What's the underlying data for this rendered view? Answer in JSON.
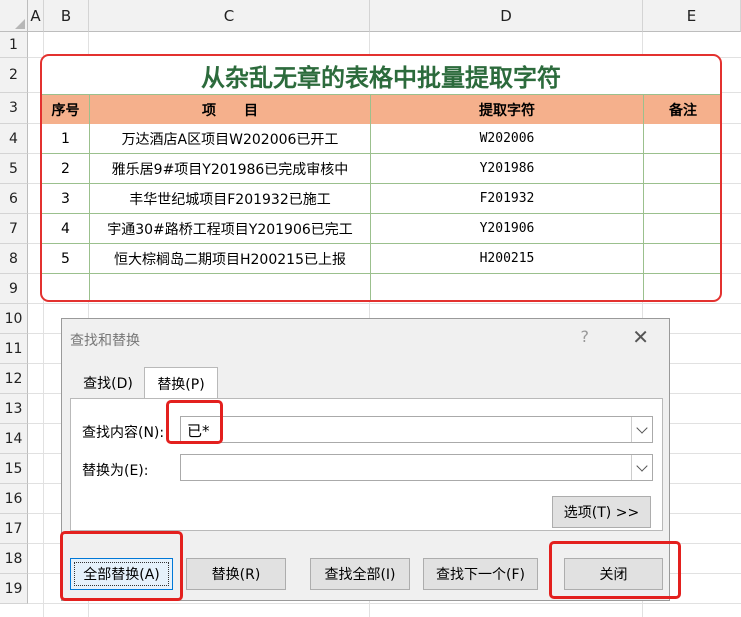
{
  "sheet": {
    "columns": [
      "A",
      "B",
      "C",
      "D",
      "E"
    ],
    "rows": [
      "1",
      "2",
      "3",
      "4",
      "5",
      "6",
      "7",
      "8",
      "9",
      "10",
      "11",
      "12",
      "13",
      "14",
      "15",
      "16",
      "17",
      "18",
      "19"
    ]
  },
  "table": {
    "title": "从杂乱无章的表格中批量提取字符",
    "headers": [
      "序号",
      "项　　目",
      "提取字符",
      "备注"
    ],
    "rows": [
      {
        "no": "1",
        "item": "万达酒店A区项目W202006已开工",
        "code": "W202006",
        "note": ""
      },
      {
        "no": "2",
        "item": "雅乐居9#项目Y201986已完成审核中",
        "code": "Y201986",
        "note": ""
      },
      {
        "no": "3",
        "item": "丰华世纪城项目F201932已施工",
        "code": "F201932",
        "note": ""
      },
      {
        "no": "4",
        "item": "宇通30#路桥工程项目Y201906已完工",
        "code": "Y201906",
        "note": ""
      },
      {
        "no": "5",
        "item": "恒大棕榈岛二期项目H200215已上报",
        "code": "H200215",
        "note": ""
      },
      {
        "no": "",
        "item": "",
        "code": "",
        "note": ""
      }
    ]
  },
  "dialog": {
    "title": "查找和替换",
    "help": "?",
    "close_glyph": "✕",
    "tab_find": "查找(D)",
    "tab_replace": "替换(P)",
    "find_label": "查找内容(N):",
    "find_value": "已*",
    "replace_label": "替换为(E):",
    "replace_value": "",
    "options_button": "选项(T) >>",
    "replace_all_button": "全部替换(A)",
    "replace_button": "替换(R)",
    "find_all_button": "查找全部(I)",
    "find_next_button": "查找下一个(F)",
    "close_button": "关闭"
  },
  "colors": {
    "highlight": "#e3201e",
    "title_text": "#2c6b3c",
    "header_fill": "#f5b08c"
  }
}
